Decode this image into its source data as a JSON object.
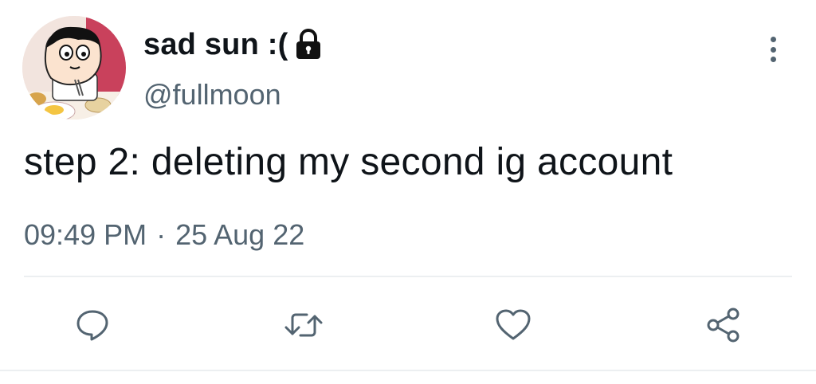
{
  "tweet": {
    "display_name": "sad sun :(",
    "handle": "@fullmoon",
    "text": "step 2: deleting my second ig account",
    "time": "09:49 PM",
    "separator": "·",
    "date": "25 Aug 22"
  },
  "icons": {
    "lock": "lock-icon",
    "more": "more-vertical-icon",
    "reply": "reply-icon",
    "retweet": "retweet-icon",
    "like": "heart-icon",
    "share": "share-icon"
  },
  "colors": {
    "text": "#0f1419",
    "secondary": "#536471",
    "divider": "#eceff1"
  }
}
